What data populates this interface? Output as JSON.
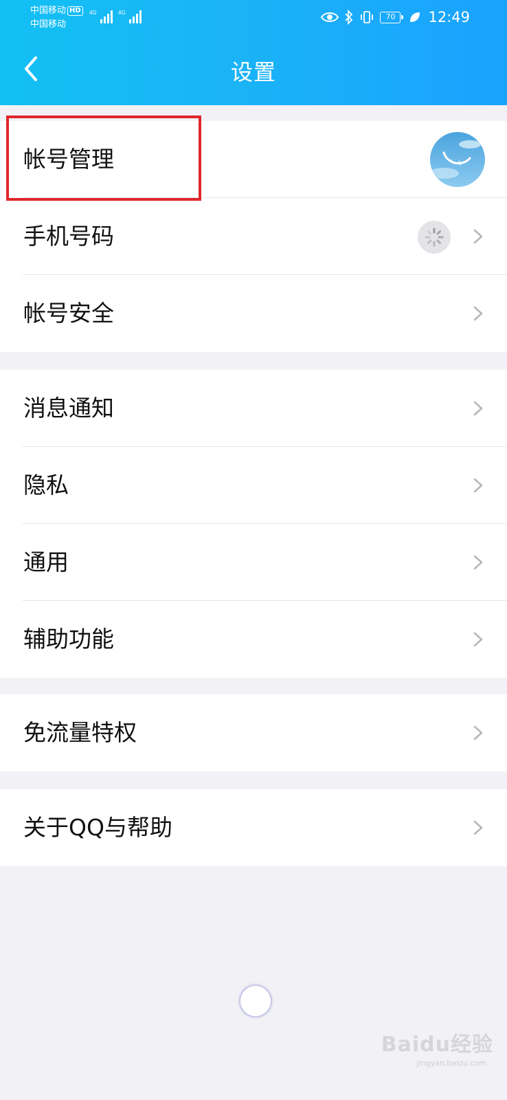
{
  "status_bar": {
    "carrier_1": "中国移动",
    "hd_badge": "HD",
    "carrier_2": "中国移动",
    "network_1": "4G",
    "network_2": "4G",
    "battery": "70",
    "time": "12:49"
  },
  "header": {
    "title": "设置"
  },
  "groups": [
    {
      "items": [
        {
          "label": "帐号管理",
          "accessory": "avatar"
        },
        {
          "label": "手机号码",
          "accessory": "loading"
        },
        {
          "label": "帐号安全"
        }
      ]
    },
    {
      "items": [
        {
          "label": "消息通知"
        },
        {
          "label": "隐私"
        },
        {
          "label": "通用"
        },
        {
          "label": "辅助功能"
        }
      ]
    },
    {
      "items": [
        {
          "label": "免流量特权"
        }
      ]
    },
    {
      "items": [
        {
          "label": "关于QQ与帮助"
        }
      ]
    }
  ],
  "watermark": {
    "brand": "Baidu经验",
    "url": "jingyan.baidu.com"
  },
  "colors": {
    "header_start": "#12c0f4",
    "header_end": "#1aa2ff",
    "highlight": "#e0262d",
    "background": "#f2f2f6"
  }
}
